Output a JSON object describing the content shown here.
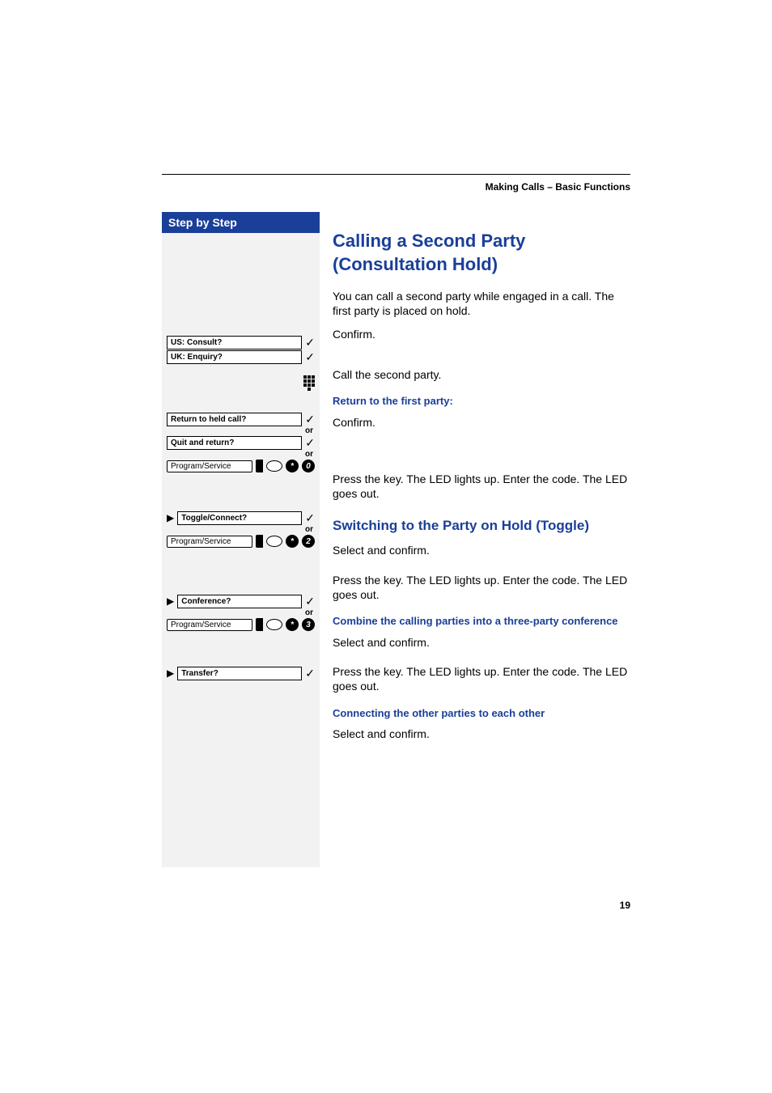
{
  "header": "Making Calls – Basic Functions",
  "step_header": "Step by Step",
  "h1": "Calling a Second Party (Consultation Hold)",
  "intro": "You can call a second party while engaged in a call. The first party is placed on hold.",
  "display": {
    "consult_us": "US: Consult?",
    "consult_uk": "UK: Enquiry?",
    "return_held": "Return to held call?",
    "quit_return": "Quit and return?",
    "toggle": "Toggle/Connect?",
    "conference": "Conference?",
    "transfer": "Transfer?"
  },
  "labels": {
    "program_service": "Program/Service",
    "or": "or"
  },
  "keys": {
    "star": "*",
    "k0": "0",
    "k2": "2",
    "k3": "3"
  },
  "text": {
    "confirm": "Confirm.",
    "call_second": "Call the second party.",
    "return_first_h": "Return to the first party:",
    "press_key": "Press the key. The LED lights up. Enter the code. The LED goes out.",
    "toggle_h": "Switching to the Party on Hold (Toggle)",
    "select_confirm": "Select and confirm.",
    "combine_h": "Combine the calling parties into a three-party conference",
    "connecting_h": "Connecting the other parties to each other"
  },
  "page_number": "19"
}
